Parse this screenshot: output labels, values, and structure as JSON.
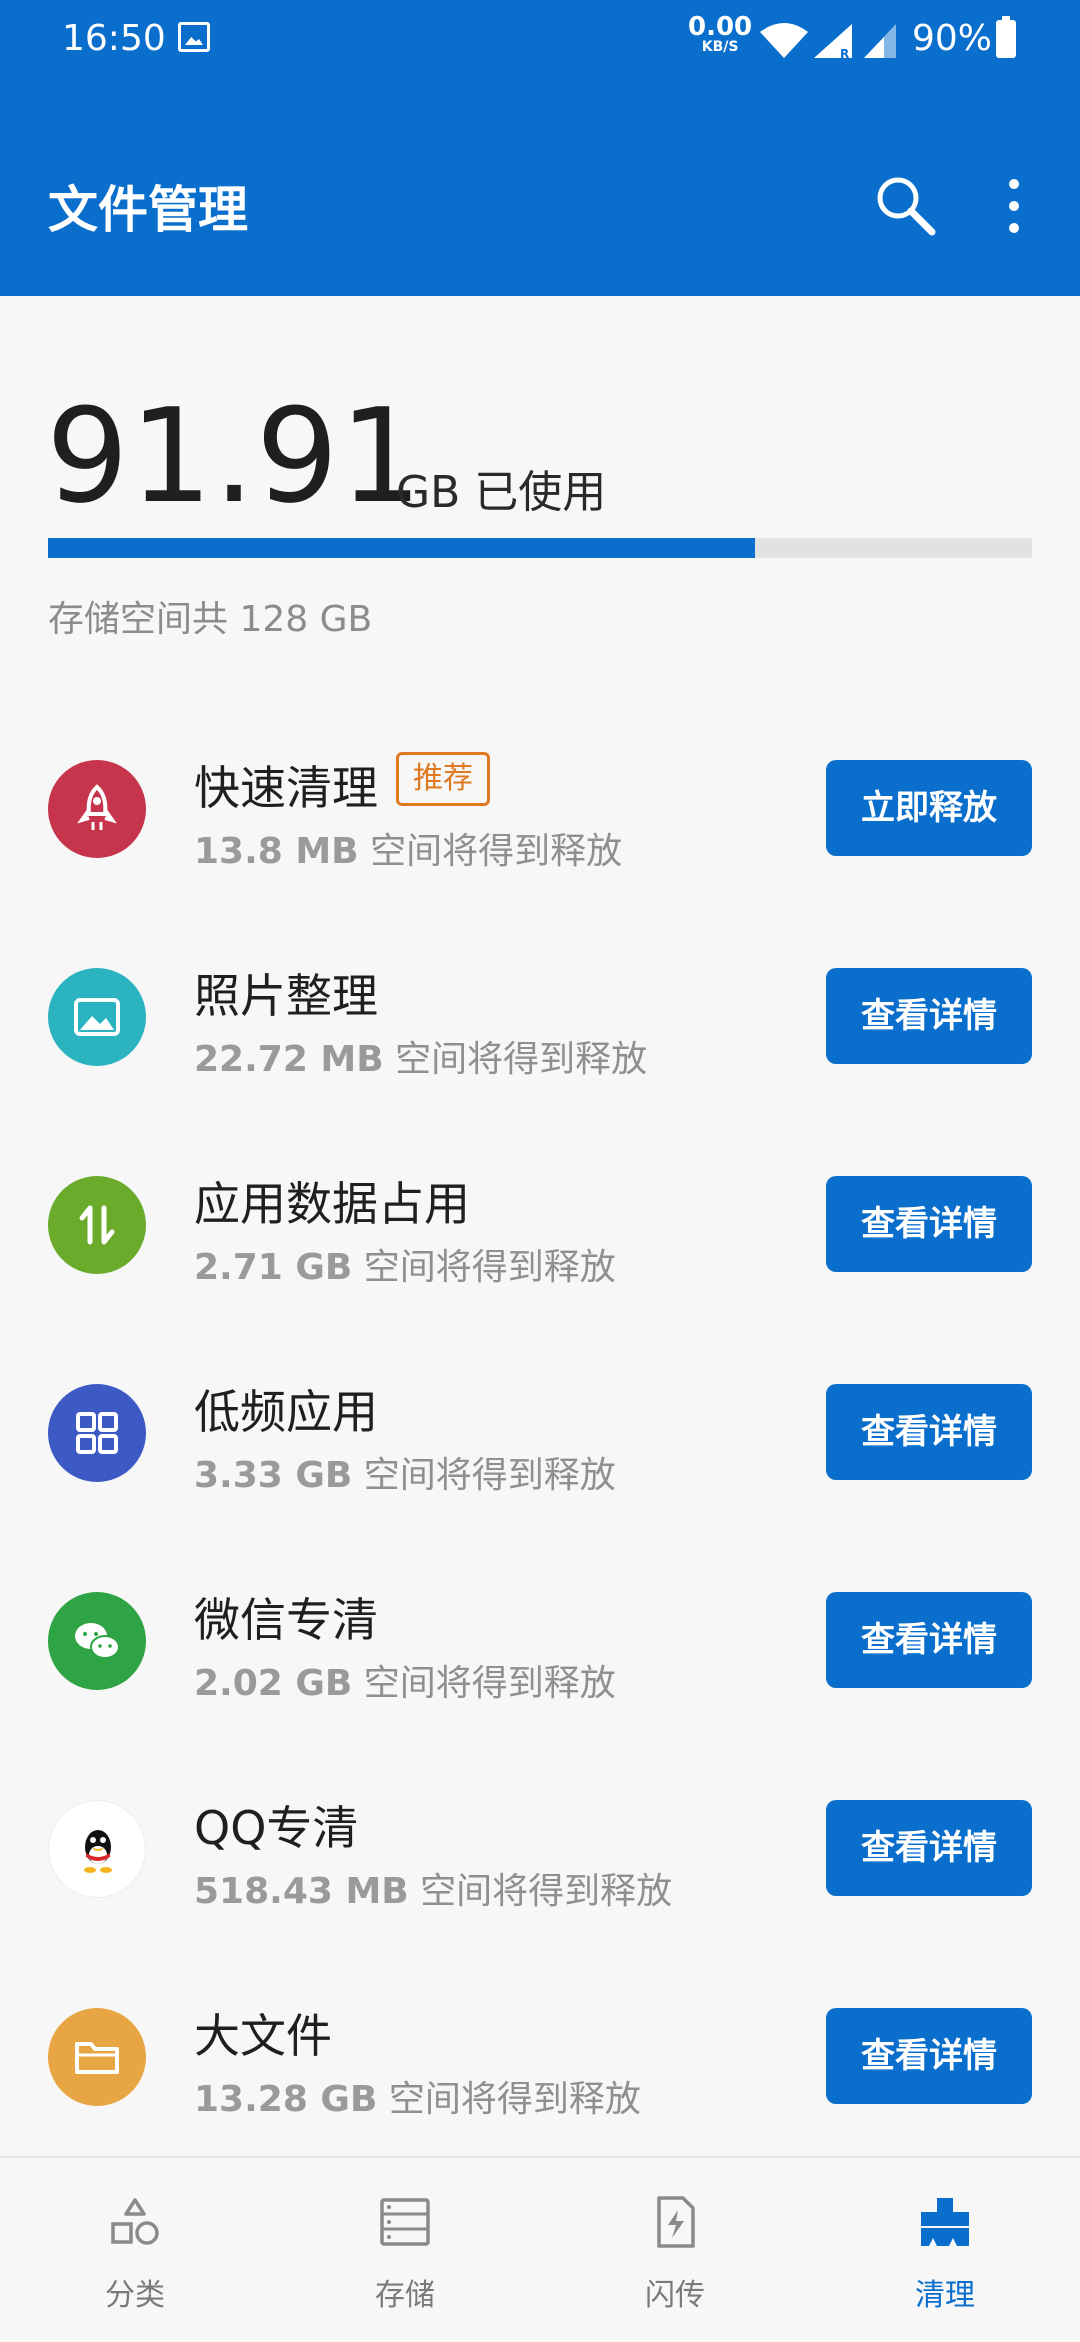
{
  "status": {
    "time": "16:50",
    "net_speed_value": "0.00",
    "net_speed_unit": "KB/S",
    "battery": "90%",
    "icons": [
      "photo-icon",
      "wifi-icon",
      "signal-icon",
      "signal-icon",
      "battery-icon"
    ]
  },
  "appbar": {
    "title": "文件管理",
    "search_icon": "search-icon",
    "more_icon": "more-vertical-icon"
  },
  "storage": {
    "used_value": "91.91",
    "used_unit": "GB 已使用",
    "used_fraction": 0.718,
    "total_text": "存储空间共 128 GB"
  },
  "rows": [
    {
      "title": "快速清理",
      "badge": "推荐",
      "size": "13.8 MB",
      "suffix": " 空间将得到释放",
      "button": "立即释放",
      "icon": "rocket-icon",
      "color": "#c7354c"
    },
    {
      "title": "照片整理",
      "size": "22.72 MB",
      "suffix": " 空间将得到释放",
      "button": "查看详情",
      "icon": "image-icon",
      "color": "#2bb3c0"
    },
    {
      "title": "应用数据占用",
      "size": "2.71 GB",
      "suffix": " 空间将得到释放",
      "button": "查看详情",
      "icon": "transfer-icon",
      "color": "#6aab2c"
    },
    {
      "title": "低频应用",
      "size": "3.33 GB",
      "suffix": " 空间将得到释放",
      "button": "查看详情",
      "icon": "grid-icon",
      "color": "#3d59c4"
    },
    {
      "title": "微信专清",
      "size": "2.02 GB",
      "suffix": " 空间将得到释放",
      "button": "查看详情",
      "icon": "wechat-icon",
      "color": "#2ea445"
    },
    {
      "title": "QQ专清",
      "size": "518.43 MB",
      "suffix": " 空间将得到释放",
      "button": "查看详情",
      "icon": "qq-penguin-icon",
      "color": "#ffffff"
    },
    {
      "title": "大文件",
      "size": "13.28 GB",
      "suffix": " 空间将得到释放",
      "button": "查看详情",
      "icon": "folder-icon",
      "color": "#e8a543"
    }
  ],
  "nav": [
    {
      "label": "分类",
      "icon": "category-icon",
      "active": false
    },
    {
      "label": "存储",
      "icon": "storage-icon",
      "active": false
    },
    {
      "label": "闪传",
      "icon": "flash-transfer-icon",
      "active": false
    },
    {
      "label": "清理",
      "icon": "clean-icon",
      "active": true
    }
  ],
  "colors": {
    "primary": "#0a6fcc",
    "badge": "#e07a22"
  }
}
